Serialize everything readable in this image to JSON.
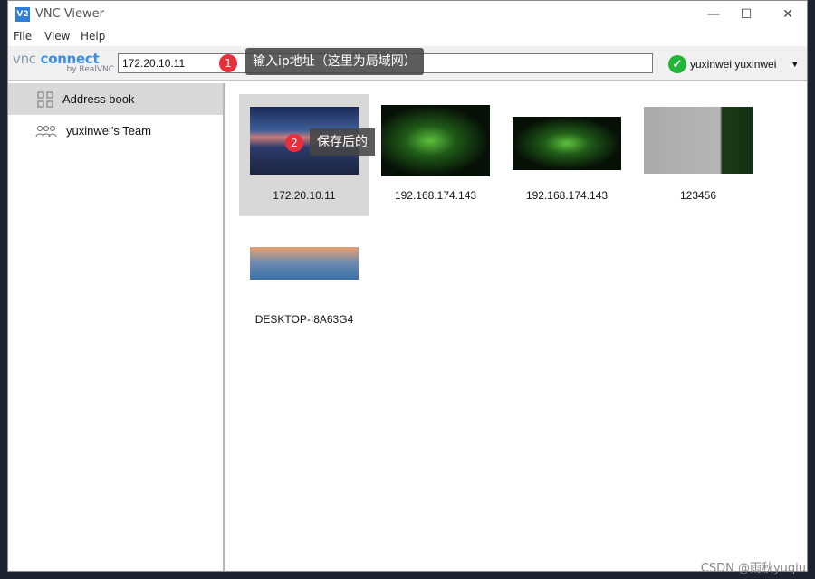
{
  "window": {
    "title": "VNC Viewer",
    "app_icon": "V2"
  },
  "menu": [
    "File",
    "View",
    "Help"
  ],
  "toolbar": {
    "logo_main": "vnc connect",
    "logo_sub": "by RealVNC",
    "address_value": "172.20.10.11",
    "user": "yuxinwei yuxinwei"
  },
  "sidebar": {
    "items": [
      {
        "label": "Address book",
        "icon": "grid-icon",
        "selected": true
      },
      {
        "label": "yuxinwei's Team",
        "icon": "team-icon",
        "selected": false
      }
    ]
  },
  "connections": [
    {
      "label": "172.20.10.11",
      "selected": true
    },
    {
      "label": "192.168.174.143"
    },
    {
      "label": "192.168.174.143"
    },
    {
      "label": "123456"
    },
    {
      "label": "DESKTOP-I8A63G4"
    }
  ],
  "annotations": [
    {
      "num": "1",
      "text": "输入ip地址（这里为局域网）"
    },
    {
      "num": "2",
      "text": "保存后的"
    }
  ],
  "watermark": "CSDN @雨秋yuqiu",
  "colors": {
    "accent": "#3a8fe0",
    "status_ok": "#22b53a",
    "badge": "#e8303a"
  }
}
